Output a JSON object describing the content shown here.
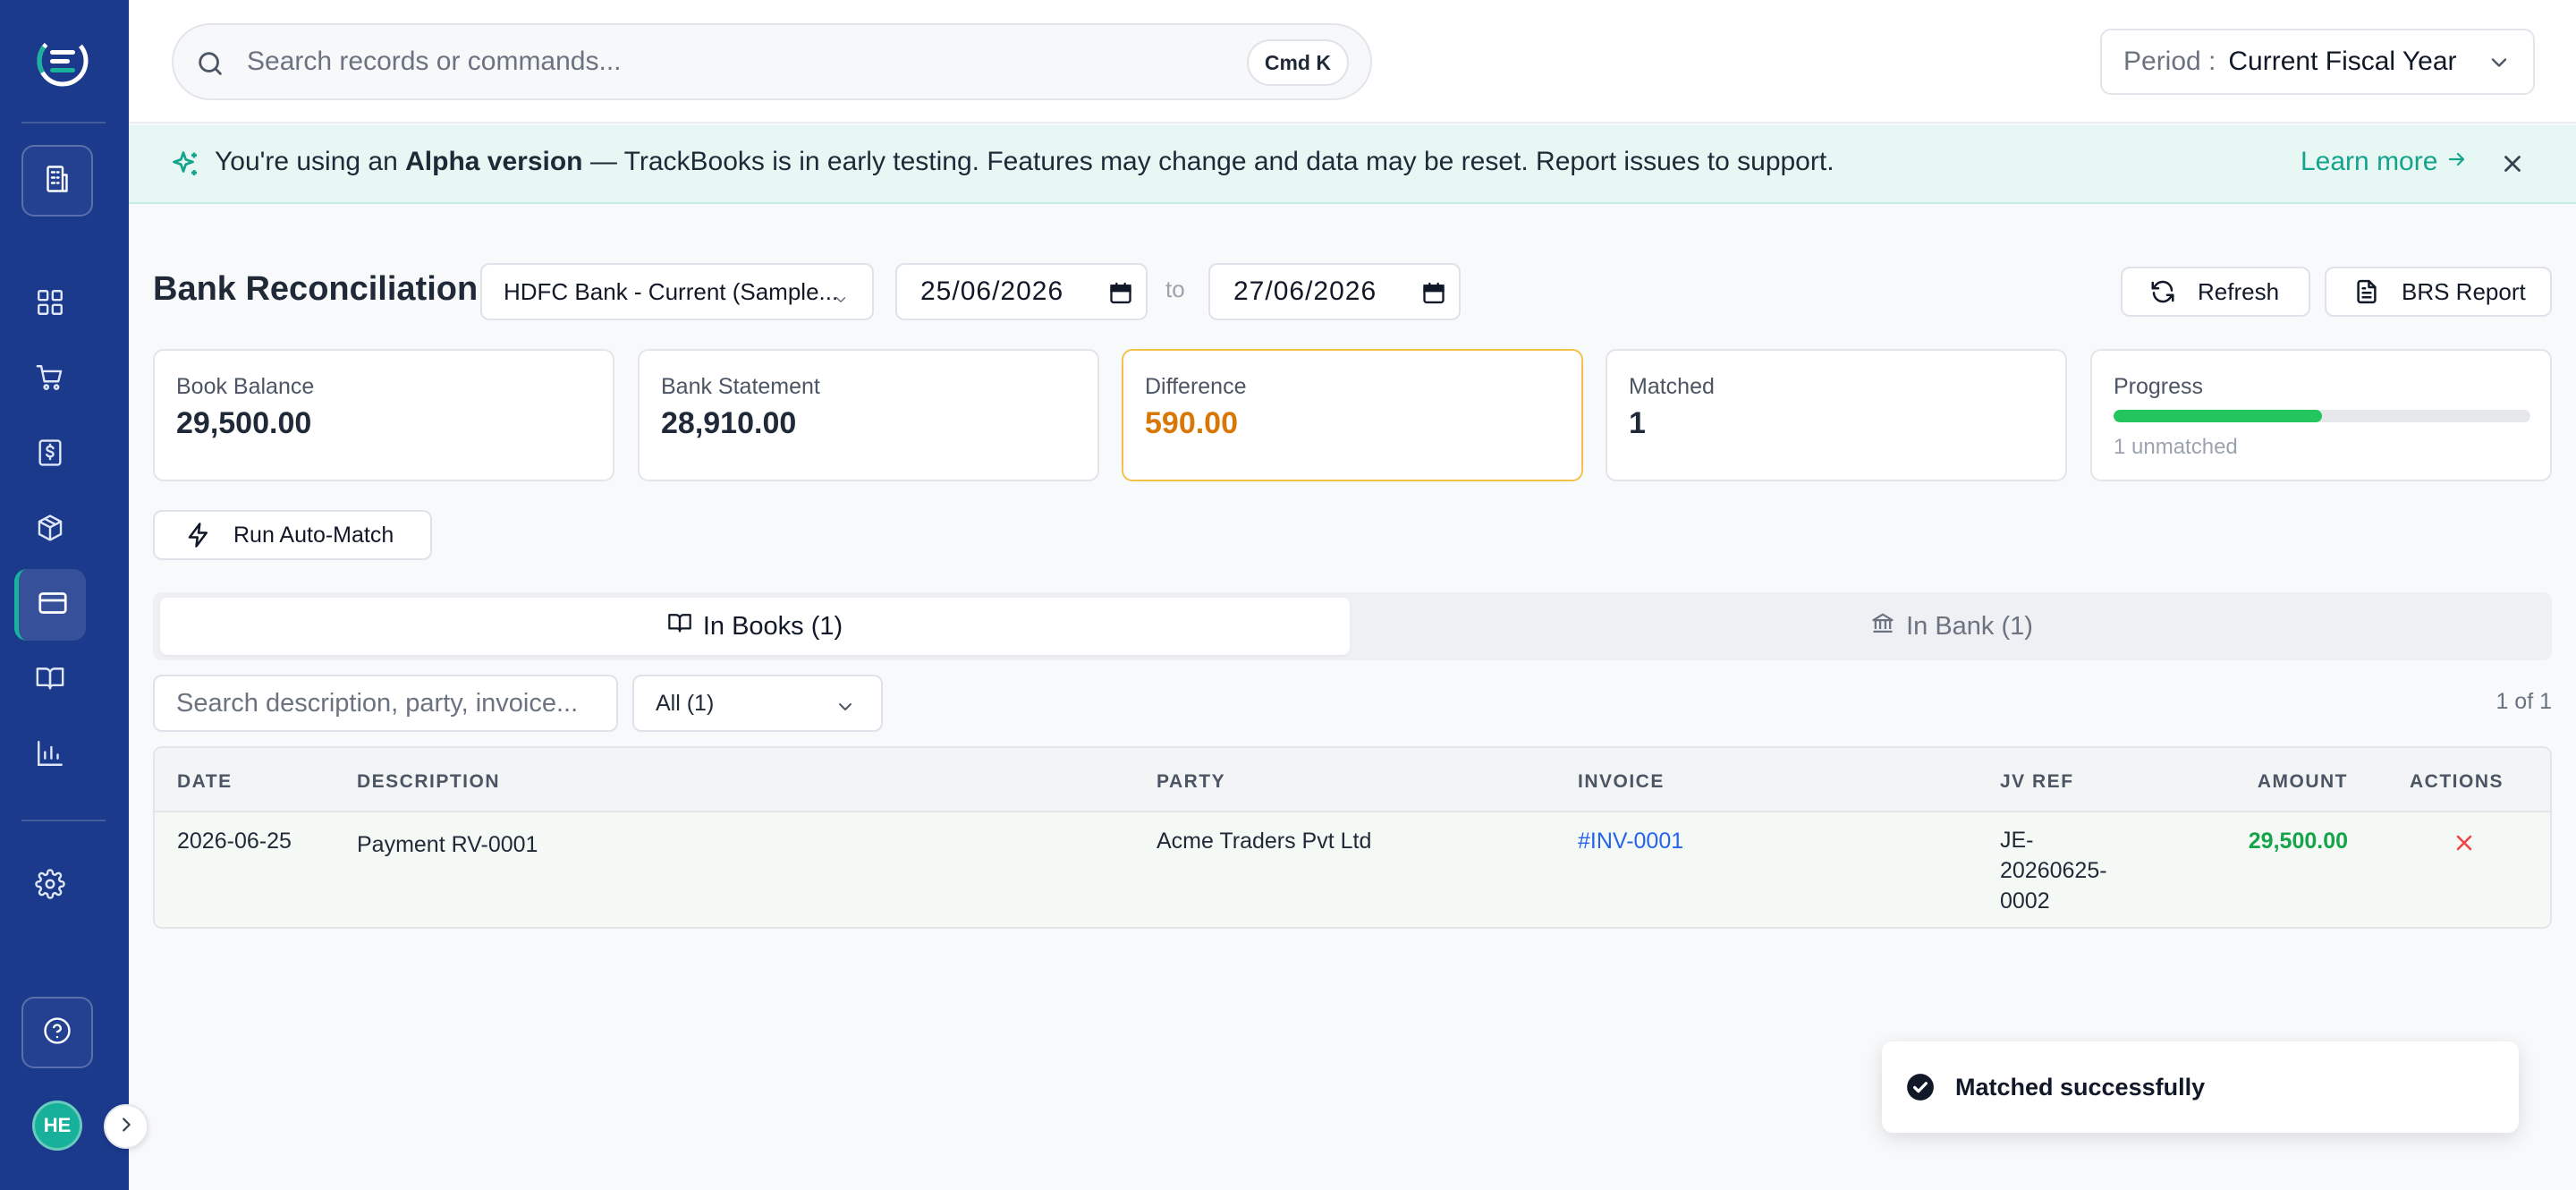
{
  "sidebar": {
    "avatar_initials": "HE",
    "items": [
      {
        "icon": "building-icon"
      },
      {
        "icon": "dashboard-icon"
      },
      {
        "icon": "cart-icon"
      },
      {
        "icon": "invoice-dollar-icon"
      },
      {
        "icon": "box-icon"
      },
      {
        "icon": "credit-card-icon",
        "active": true
      },
      {
        "icon": "book-icon"
      },
      {
        "icon": "bar-chart-icon"
      },
      {
        "icon": "gear-icon"
      },
      {
        "icon": "help-icon"
      }
    ],
    "colors": {
      "background": "#1b3a8c",
      "accent": "#18b39a"
    }
  },
  "topbar": {
    "search_placeholder": "Search records or commands...",
    "shortcut": "Cmd K",
    "period_label": "Period :",
    "period_value": "Current Fiscal Year"
  },
  "banner": {
    "prefix": "You're using an ",
    "highlight": "Alpha version",
    "suffix": " — TrackBooks is in early testing. Features may change and data may be reset. Report issues to support.",
    "learn_more": "Learn more"
  },
  "page": {
    "title": "Bank Reconciliation",
    "account": "HDFC Bank - Current (Sample...",
    "date_from": "25/06/2026",
    "to_label": "to",
    "date_to": "27/06/2026",
    "refresh_label": "Refresh",
    "brs_label": "BRS Report",
    "automatch_label": "Run Auto-Match"
  },
  "stats": {
    "book_balance": {
      "label": "Book Balance",
      "value": "29,500.00"
    },
    "bank_statement": {
      "label": "Bank Statement",
      "value": "28,910.00"
    },
    "difference": {
      "label": "Difference",
      "value": "590.00"
    },
    "matched": {
      "label": "Matched",
      "value": "1"
    },
    "progress": {
      "label": "Progress",
      "fraction": 0.5,
      "sub": "1 unmatched"
    }
  },
  "tabs": {
    "books": "In Books (1)",
    "bank": "In Bank (1)"
  },
  "filters": {
    "search_placeholder": "Search description, party, invoice...",
    "status_value": "All (1)",
    "pager": "1 of 1"
  },
  "table": {
    "headers": {
      "date": "DATE",
      "description": "DESCRIPTION",
      "party": "PARTY",
      "invoice": "INVOICE",
      "jv_ref": "JV REF",
      "amount": "AMOUNT",
      "actions": "ACTIONS"
    },
    "rows": [
      {
        "date": "2026-06-25",
        "description": "Payment RV-0001",
        "party": "Acme Traders Pvt Ltd",
        "invoice": "#INV-0001",
        "jv_ref_1": "JE-",
        "jv_ref_2": "20260625-",
        "jv_ref_3": "0002",
        "amount": "29,500.00"
      }
    ]
  },
  "toast": {
    "message": "Matched successfully"
  }
}
